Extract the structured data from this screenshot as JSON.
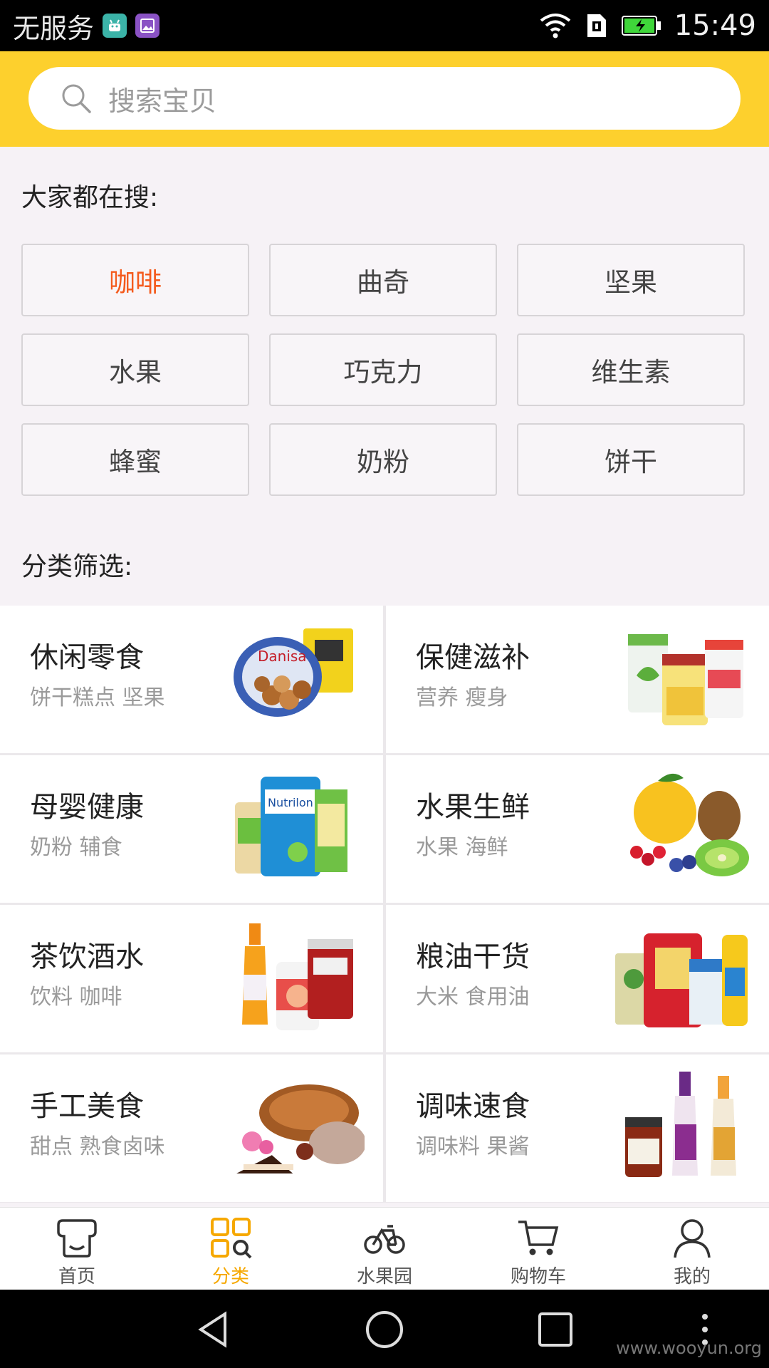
{
  "status_bar": {
    "carrier": "无服务",
    "time": "15:49"
  },
  "search": {
    "placeholder": "搜索宝贝"
  },
  "hot_search": {
    "title": "大家都在搜:",
    "tags": [
      "咖啡",
      "曲奇",
      "坚果",
      "水果",
      "巧克力",
      "维生素",
      "蜂蜜",
      "奶粉",
      "饼干"
    ]
  },
  "category_filter": {
    "title": "分类筛选:",
    "items": [
      {
        "title": "休闲零食",
        "subtitle": "饼干糕点 坚果",
        "icon": "snacks-image"
      },
      {
        "title": "保健滋补",
        "subtitle": "营养 瘦身",
        "icon": "supplements-image"
      },
      {
        "title": "母婴健康",
        "subtitle": "奶粉 辅食",
        "icon": "baby-formula-image"
      },
      {
        "title": "水果生鲜",
        "subtitle": "水果 海鲜",
        "icon": "fruit-image"
      },
      {
        "title": "茶饮酒水",
        "subtitle": "饮料 咖啡",
        "icon": "drinks-image"
      },
      {
        "title": "粮油干货",
        "subtitle": "大米 食用油",
        "icon": "grain-oil-image"
      },
      {
        "title": "手工美食",
        "subtitle": "甜点 熟食卤味",
        "icon": "handmade-food-image"
      },
      {
        "title": "调味速食",
        "subtitle": "调味料 果酱",
        "icon": "condiments-image"
      }
    ]
  },
  "tab_bar": {
    "tabs": [
      {
        "label": "首页",
        "icon": "home-icon"
      },
      {
        "label": "分类",
        "icon": "category-icon",
        "active": true
      },
      {
        "label": "水果园",
        "icon": "bicycle-icon"
      },
      {
        "label": "购物车",
        "icon": "cart-icon"
      },
      {
        "label": "我的",
        "icon": "user-icon"
      }
    ],
    "active_color": "#f6a800"
  },
  "watermark": "www.wooyun.org",
  "colors": {
    "header_yellow": "#fdd02d",
    "active_tag": "#f45a1c"
  }
}
